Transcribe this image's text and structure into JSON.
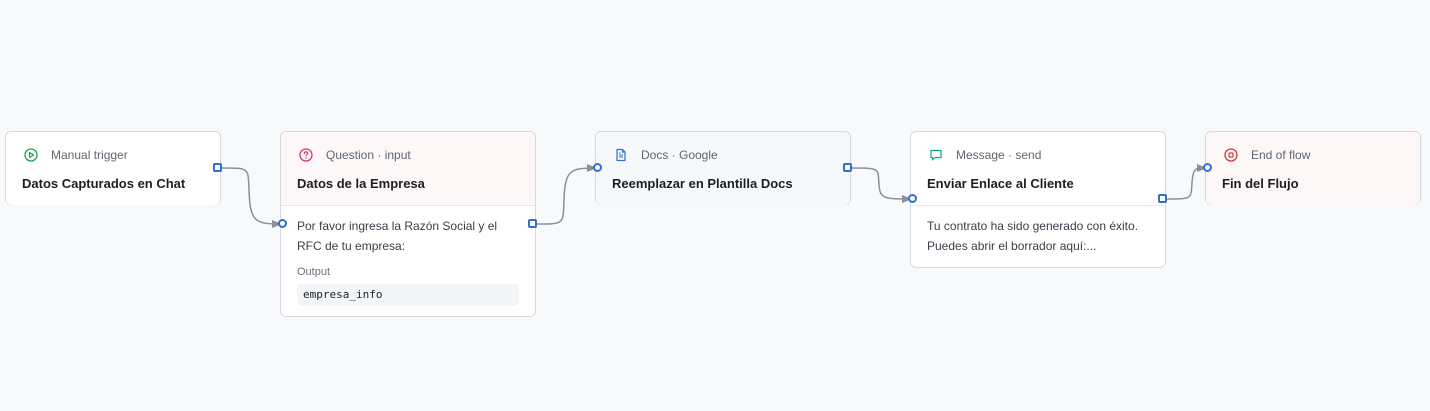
{
  "colors": {
    "edge": "#8a8f98",
    "port": "#2f6fd1",
    "trigger": "#1e9e5a",
    "question": "#d6337a",
    "docs": "#2f73c9",
    "message": "#12a38c",
    "end": "#d2373f"
  },
  "nodes": {
    "trigger": {
      "kind": "Manual trigger",
      "title": "Datos Capturados en Chat",
      "icon": "play-circle-icon"
    },
    "question": {
      "kind": "Question · input",
      "title": "Datos de la Empresa",
      "icon": "question-circle-icon",
      "body": "Por favor ingresa la Razón Social y el RFC de tu empresa:",
      "output_label": "Output",
      "output_value": "empresa_info"
    },
    "docs": {
      "kind": "Docs · Google",
      "title": "Reemplazar en Plantilla Docs",
      "icon": "document-icon"
    },
    "message": {
      "kind": "Message · send",
      "title": "Enviar Enlace al Cliente",
      "icon": "chat-bubble-icon",
      "body": "Tu contrato ha sido generado con éxito. Puedes abrir el borrador aquí:..."
    },
    "end": {
      "kind": "End of flow",
      "title": "Fin del Flujo",
      "icon": "stop-circle-icon"
    }
  }
}
